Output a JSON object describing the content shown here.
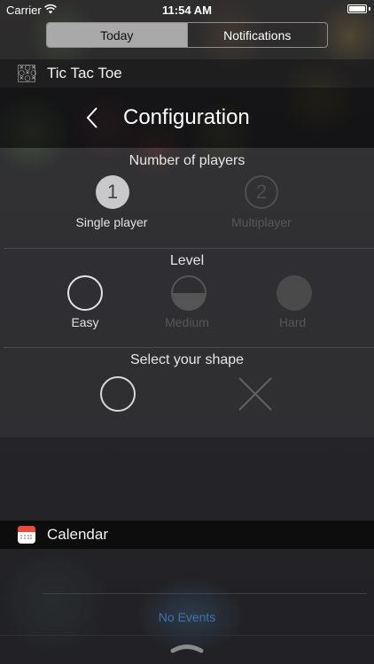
{
  "status_bar": {
    "carrier": "Carrier",
    "time": "11:54 AM",
    "battery_level": 1.0
  },
  "tabs": [
    {
      "label": "Today",
      "active": true
    },
    {
      "label": "Notifications",
      "active": false
    }
  ],
  "ttt_widget": {
    "title": "Tic Tac Toe",
    "icon": "tic-tac-toe-icon",
    "config_title": "Configuration",
    "players": {
      "title": "Number of players",
      "options": [
        {
          "number": "1",
          "label": "Single player",
          "selected": true
        },
        {
          "number": "2",
          "label": "Multiplayer",
          "selected": false
        }
      ]
    },
    "level": {
      "title": "Level",
      "options": [
        {
          "label": "Easy",
          "selected": true
        },
        {
          "label": "Medium",
          "selected": false
        },
        {
          "label": "Hard",
          "selected": false
        }
      ]
    },
    "shape": {
      "title": "Select your shape",
      "options": [
        {
          "name": "circle-icon",
          "selected": true
        },
        {
          "name": "cross-icon",
          "selected": false
        }
      ]
    }
  },
  "calendar_widget": {
    "title": "Calendar",
    "icon": "calendar-icon",
    "empty_text": "No Events"
  },
  "colors": {
    "accent_blue": "#3f74a8",
    "calendar_red": "#e94a3c"
  }
}
